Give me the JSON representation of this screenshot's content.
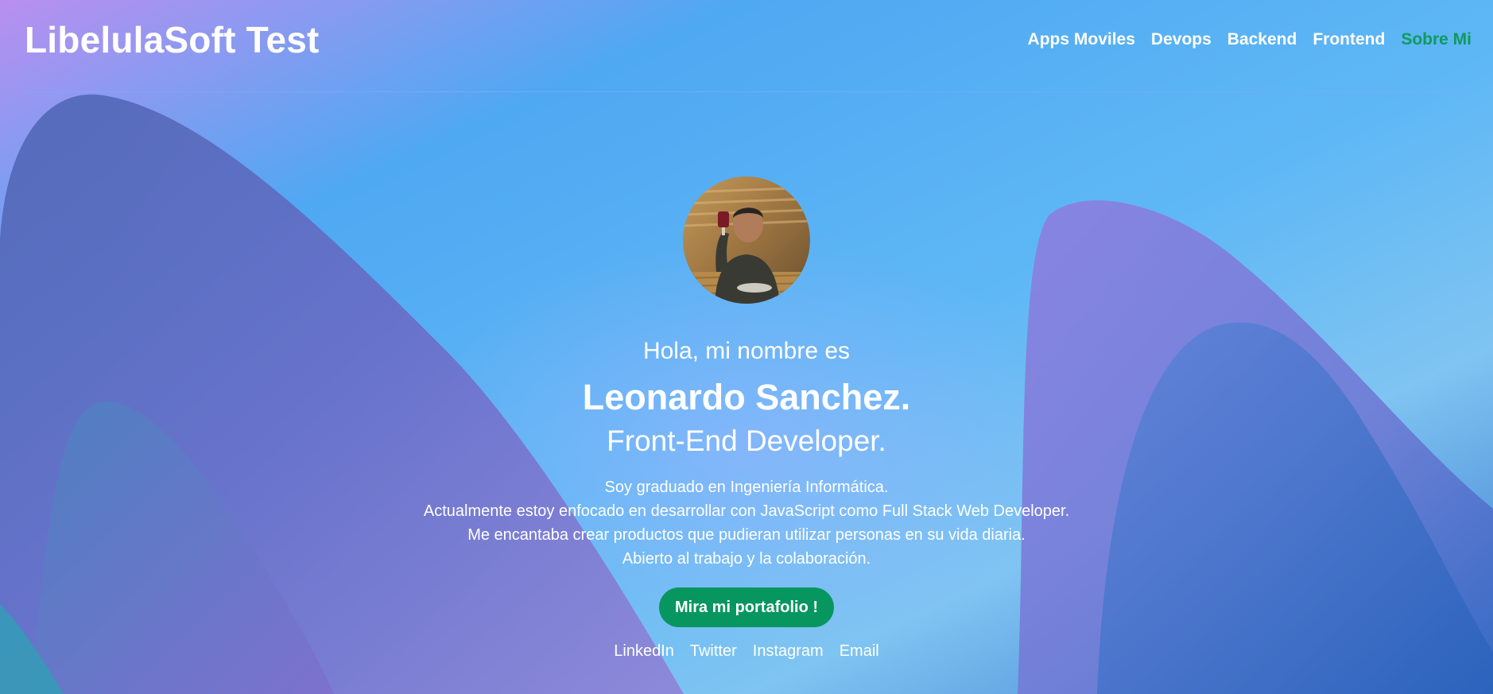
{
  "header": {
    "brand": "LibelulaSoft Test",
    "nav": [
      {
        "label": "Apps Moviles"
      },
      {
        "label": "Devops"
      },
      {
        "label": "Backend"
      },
      {
        "label": "Frontend"
      },
      {
        "label": "Sobre Mi"
      }
    ],
    "active_nav": "Sobre Mi",
    "active_color": "#0f9a5f"
  },
  "hero": {
    "avatar_icon": "profile-photo",
    "greeting": "Hola, mi nombre es",
    "name": "Leonardo Sanchez.",
    "role": "Front-End Developer.",
    "bio": [
      "Soy graduado en Ingeniería Informática.",
      "Actualmente estoy enfocado en desarrollar con JavaScript como Full Stack Web Developer.",
      "Me encantaba crear productos que pudieran utilizar personas en su vida diaria.",
      "Abierto al trabajo y la colaboración."
    ],
    "cta_label": "Mira mi portafolio !",
    "cta_color": "#07965f"
  },
  "social": [
    {
      "label": "LinkedIn"
    },
    {
      "label": "Twitter"
    },
    {
      "label": "Instagram"
    },
    {
      "label": "Email"
    }
  ]
}
